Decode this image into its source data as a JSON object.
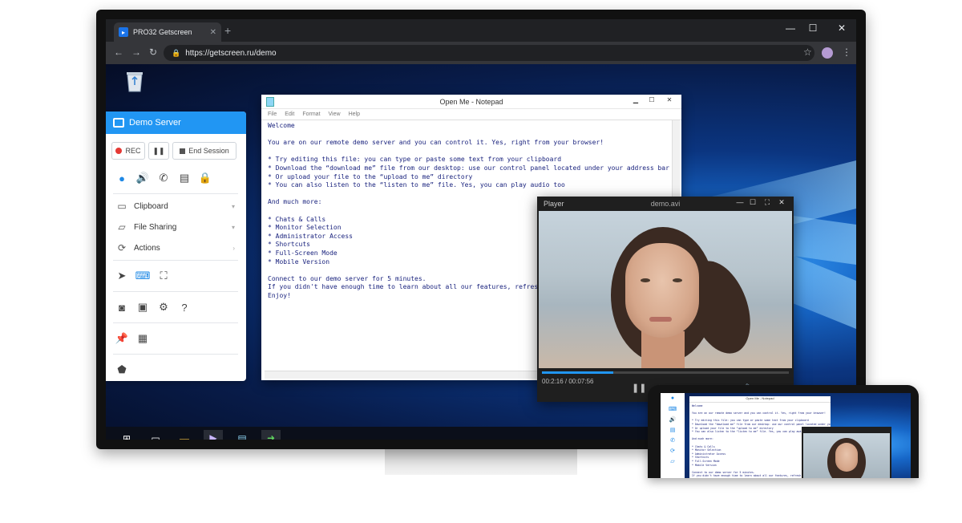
{
  "browser": {
    "tab_title": "PRO32 Getscreen",
    "tab_close": "✕",
    "new_tab": "+",
    "url": "https://getscreen.ru/demo",
    "window_controls": [
      "—",
      "☐",
      "✕"
    ]
  },
  "panel": {
    "server_name": "Demo Server",
    "rec_label": "REC",
    "pause_label": "❚❚",
    "end_session_label": "End Session",
    "menu": [
      {
        "label": "Clipboard",
        "icon": "clipboard-icon"
      },
      {
        "label": "File Sharing",
        "icon": "folder-icon"
      },
      {
        "label": "Actions",
        "icon": "actions-icon"
      }
    ]
  },
  "notepad": {
    "title": "Open Me - Notepad",
    "menu": [
      "File",
      "Edit",
      "Format",
      "View",
      "Help"
    ],
    "lines": [
      "Welcome",
      "",
      "You are on our remote demo server and you can control it. Yes, right from your browser!",
      "",
      "* Try editing this file: you can type or paste some text from your clipboard",
      "* Download the “download me” file from our desktop: use our control panel located under your address bar",
      "* Or upload your file to the “upload to me” directory",
      "* You can also listen to the “listen to me” file. Yes, you can play audio too",
      "",
      "And much more:",
      "",
      "* Chats & Calls",
      "* Monitor Selection",
      "* Administrator Access",
      "* Shortcuts",
      "* Full-Screen Mode",
      "* Mobile Version",
      "",
      "Connect to our demo server for 5 minutes.",
      "If you didn't have enough time to learn about all our features, refresh",
      "Enjoy!"
    ]
  },
  "player": {
    "title": "Player",
    "file": "demo.avi",
    "time": "00:2:16 / 00:07:56",
    "progress": 0.29
  },
  "colors": {
    "accent": "#2196f3",
    "rec": "#e53935"
  }
}
